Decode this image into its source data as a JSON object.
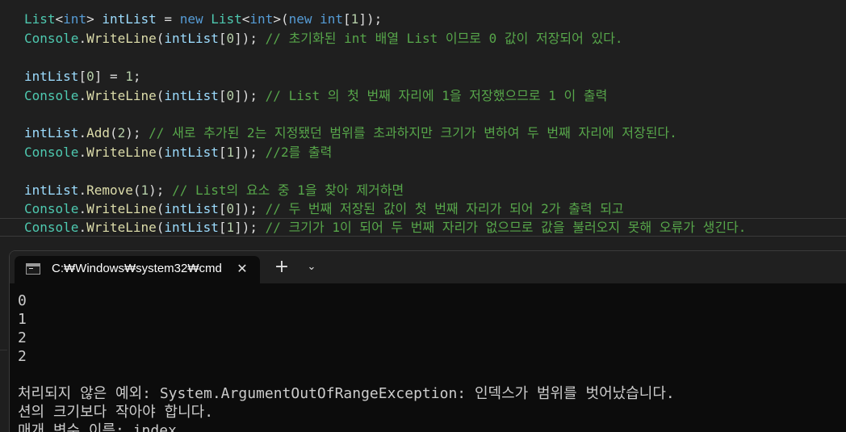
{
  "editor": {
    "lines": [
      [
        [
          "tk-type",
          "List"
        ],
        [
          "tk-p",
          "<"
        ],
        [
          "tk-kw",
          "int"
        ],
        [
          "tk-p",
          "> "
        ],
        [
          "tk-id",
          "intList"
        ],
        [
          "tk-p",
          " = "
        ],
        [
          "tk-kw",
          "new"
        ],
        [
          "tk-p",
          " "
        ],
        [
          "tk-type",
          "List"
        ],
        [
          "tk-p",
          "<"
        ],
        [
          "tk-kw",
          "int"
        ],
        [
          "tk-p",
          ">("
        ],
        [
          "tk-kw",
          "new"
        ],
        [
          "tk-p",
          " "
        ],
        [
          "tk-kw",
          "int"
        ],
        [
          "tk-p",
          "["
        ],
        [
          "tk-num",
          "1"
        ],
        [
          "tk-p",
          "]);"
        ]
      ],
      [
        [
          "tk-type",
          "Console"
        ],
        [
          "tk-p",
          "."
        ],
        [
          "tk-m",
          "WriteLine"
        ],
        [
          "tk-p",
          "("
        ],
        [
          "tk-id",
          "intList"
        ],
        [
          "tk-p",
          "["
        ],
        [
          "tk-num",
          "0"
        ],
        [
          "tk-p",
          "]); "
        ],
        [
          "tk-c",
          "// 초기화된 int 배열 List 이므로 0 값이 저장되어 있다."
        ]
      ],
      [],
      [
        [
          "tk-id",
          "intList"
        ],
        [
          "tk-p",
          "["
        ],
        [
          "tk-num",
          "0"
        ],
        [
          "tk-p",
          "] = "
        ],
        [
          "tk-num",
          "1"
        ],
        [
          "tk-p",
          ";"
        ]
      ],
      [
        [
          "tk-type",
          "Console"
        ],
        [
          "tk-p",
          "."
        ],
        [
          "tk-m",
          "WriteLine"
        ],
        [
          "tk-p",
          "("
        ],
        [
          "tk-id",
          "intList"
        ],
        [
          "tk-p",
          "["
        ],
        [
          "tk-num",
          "0"
        ],
        [
          "tk-p",
          "]); "
        ],
        [
          "tk-c",
          "// List 의 첫 번째 자리에 1을 저장했으므로 1 이 출력"
        ]
      ],
      [],
      [
        [
          "tk-id",
          "intList"
        ],
        [
          "tk-p",
          "."
        ],
        [
          "tk-m",
          "Add"
        ],
        [
          "tk-p",
          "("
        ],
        [
          "tk-num",
          "2"
        ],
        [
          "tk-p",
          "); "
        ],
        [
          "tk-c",
          "// 새로 추가된 2는 지정됐던 범위를 초과하지만 크기가 변하여 두 번째 자리에 저장된다."
        ]
      ],
      [
        [
          "tk-type",
          "Console"
        ],
        [
          "tk-p",
          "."
        ],
        [
          "tk-m",
          "WriteLine"
        ],
        [
          "tk-p",
          "("
        ],
        [
          "tk-id",
          "intList"
        ],
        [
          "tk-p",
          "["
        ],
        [
          "tk-num",
          "1"
        ],
        [
          "tk-p",
          "]); "
        ],
        [
          "tk-c",
          "//2를 출력"
        ]
      ],
      [],
      [
        [
          "tk-id",
          "intList"
        ],
        [
          "tk-p",
          "."
        ],
        [
          "tk-m",
          "Remove"
        ],
        [
          "tk-p",
          "("
        ],
        [
          "tk-num",
          "1"
        ],
        [
          "tk-p",
          "); "
        ],
        [
          "tk-c",
          "// List의 요소 중 1을 찾아 제거하면"
        ]
      ],
      [
        [
          "tk-type",
          "Console"
        ],
        [
          "tk-p",
          "."
        ],
        [
          "tk-m",
          "WriteLine"
        ],
        [
          "tk-p",
          "("
        ],
        [
          "tk-id",
          "intList"
        ],
        [
          "tk-p",
          "["
        ],
        [
          "tk-num",
          "0"
        ],
        [
          "tk-p",
          "]); "
        ],
        [
          "tk-c",
          "// 두 번째 저장된 값이 첫 번째 자리가 되어 2가 출력 되고"
        ]
      ],
      [
        [
          "tk-type",
          "Console"
        ],
        [
          "tk-p",
          "."
        ],
        [
          "tk-m",
          "WriteLine"
        ],
        [
          "tk-p",
          "("
        ],
        [
          "tk-id",
          "intList"
        ],
        [
          "tk-p",
          "["
        ],
        [
          "tk-num",
          "1"
        ],
        [
          "tk-p",
          "]); "
        ],
        [
          "tk-c",
          "// 크기가 1이 되어 두 번째 자리가 없으므로 값을 불러오지 못해 오류가 생긴다."
        ]
      ]
    ]
  },
  "terminal": {
    "tab_title": "C:₩Windows₩system32₩cmd",
    "close_glyph": "✕",
    "add_glyph": "+",
    "dropdown_glyph": "⌄",
    "output": [
      "0",
      "1",
      "2",
      "2",
      "",
      "처리되지 않은 예외: System.ArgumentOutOfRangeException: 인덱스가 범위를 벗어났습니다.",
      "션의 크기보다 작아야 합니다.",
      "매개 변수 이름: index"
    ]
  },
  "icons": {
    "tab_icon": "terminal-icon",
    "close_icon": "close-icon",
    "add_icon": "plus-icon",
    "dropdown_icon": "chevron-down-icon"
  },
  "colors": {
    "editor_bg": "#1f1f1f",
    "terminal_bg": "#0c0c0c",
    "comment": "#57a64a",
    "keyword": "#569cd6",
    "type": "#4ec9b0"
  }
}
